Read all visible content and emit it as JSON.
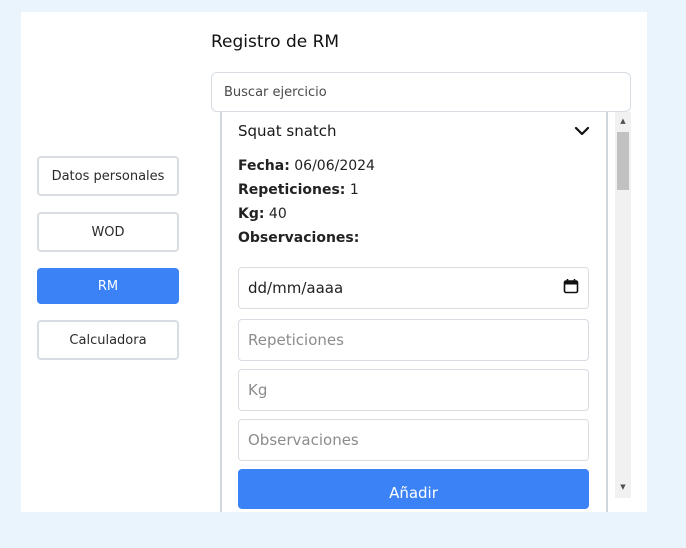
{
  "sidebar": {
    "items": [
      {
        "label": "Datos personales"
      },
      {
        "label": "WOD"
      },
      {
        "label": "RM"
      },
      {
        "label": "Calculadora"
      }
    ]
  },
  "main": {
    "title": "Registro de RM",
    "search_placeholder": "Buscar ejercicio",
    "exercise": {
      "name": "Squat snatch",
      "fecha_label": "Fecha:",
      "fecha_value": "06/06/2024",
      "reps_label": "Repeticiones:",
      "reps_value": "1",
      "kg_label": "Kg:",
      "kg_value": "40",
      "obs_label": "Observaciones:"
    },
    "form": {
      "date_value": "dd/mm/aaaa",
      "reps_placeholder": "Repeticiones",
      "kg_placeholder": "Kg",
      "obs_placeholder": "Observaciones",
      "add_label": "Añadir"
    }
  },
  "icons": {
    "chevron": "chevron-down-icon",
    "calendar": "calendar-icon"
  },
  "colors": {
    "accent": "#3b82f6",
    "page_bg": "#e9f4fc",
    "border": "#d7dde3"
  }
}
